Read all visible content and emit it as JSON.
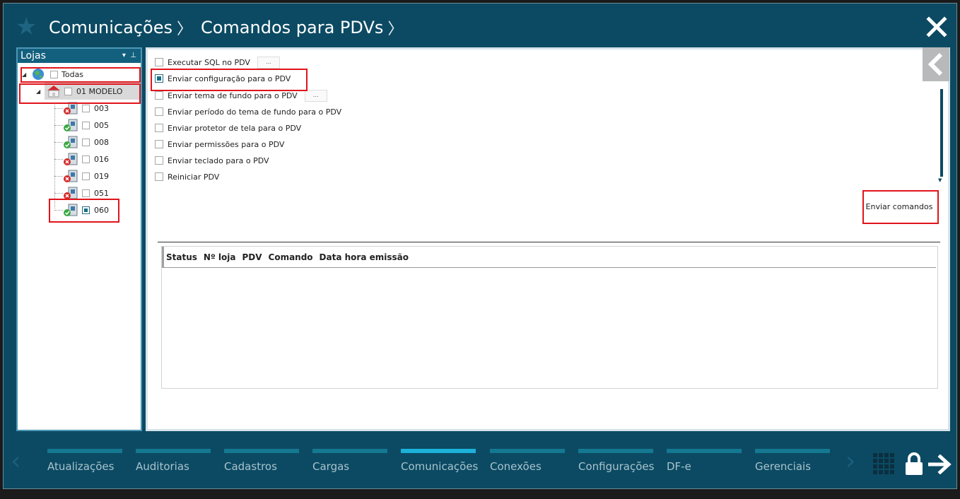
{
  "header": {
    "crumbs": [
      "Comunicações",
      "Comandos para PDVs"
    ],
    "star_icon": "star-icon",
    "close_icon": "close-icon"
  },
  "stores": {
    "title": "Lojas",
    "root": {
      "label": "Todas",
      "checked": false
    },
    "store": {
      "label": "01 MODELO",
      "checked": false
    },
    "pdvs": [
      {
        "label": "003",
        "status": "offline",
        "checked": false
      },
      {
        "label": "005",
        "status": "online",
        "checked": false
      },
      {
        "label": "008",
        "status": "online",
        "checked": false
      },
      {
        "label": "016",
        "status": "offline",
        "checked": false
      },
      {
        "label": "019",
        "status": "offline",
        "checked": false
      },
      {
        "label": "051",
        "status": "offline",
        "checked": false
      },
      {
        "label": "060",
        "status": "online",
        "checked": true
      }
    ]
  },
  "commands": [
    {
      "label": "Executar SQL no PDV",
      "checked": false,
      "has_options": true,
      "options_label": "..."
    },
    {
      "label": "Enviar configuração para o PDV",
      "checked": true,
      "has_options": false
    },
    {
      "label": "Enviar tema de fundo para o PDV",
      "checked": false,
      "has_options": true,
      "options_label": "..."
    },
    {
      "label": "Enviar período do tema de fundo para o PDV",
      "checked": false,
      "has_options": false
    },
    {
      "label": "Enviar protetor de tela para o PDV",
      "checked": false,
      "has_options": false
    },
    {
      "label": "Enviar permissões para o PDV",
      "checked": false,
      "has_options": false
    },
    {
      "label": "Enviar teclado para o PDV",
      "checked": false,
      "has_options": false
    },
    {
      "label": "Reiniciar PDV",
      "checked": false,
      "has_options": false
    }
  ],
  "send_button": "Enviar comandos",
  "grid": {
    "columns": [
      "Status",
      "Nº loja",
      "PDV",
      "Comando",
      "Data hora emissão"
    ],
    "rows": []
  },
  "bottom_nav": {
    "tabs": [
      "Atualizações",
      "Auditorias",
      "Cadastros",
      "Cargas",
      "Comunicações",
      "Conexões",
      "Configurações",
      "DF-e",
      "Gerenciais"
    ],
    "active": "Comunicações"
  },
  "colors": {
    "window_bg": "#0c4a63",
    "accent": "#1bb1d8",
    "tab_bar": "#157891",
    "highlight": "#e0141b"
  }
}
